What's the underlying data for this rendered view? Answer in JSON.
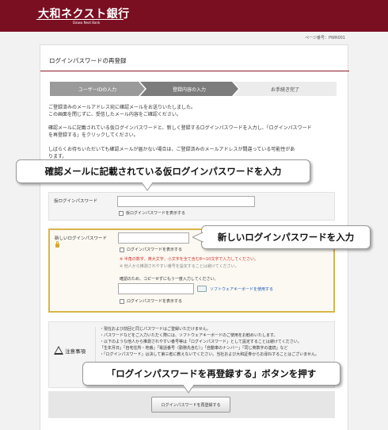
{
  "header": {
    "logo": "大和ネクスト銀行",
    "logo_sub": "Daiwa Next Bank",
    "brand_color": "#7a0f22"
  },
  "page_no": "ページ番号：PWR001",
  "card": {
    "title": "ログインパスワードの再登録",
    "steps": [
      {
        "label": "ユーザーIDの入力",
        "state": "done"
      },
      {
        "label": "登録内容の入力",
        "state": "current"
      },
      {
        "label": "お手続き完了",
        "state": "todo"
      }
    ],
    "intro": [
      "ご登録済みのメールアドレス宛に確認メールをお送りいたしました。",
      "この画面を閉じずに、受信したメール内容をご確認ください。"
    ],
    "instructions": [
      "確認メールに記載されている仮ログインパスワードと、新しく登録するログインパスワードを入力し、「ログインパスワード",
      "を再登録する」をクリックしてください。"
    ],
    "info": [
      "しばらくお待ちいただいても確認メールが届かない場合は、ご登録済みのメールアドレスが間違っている可能性があ",
      "ります。"
    ]
  },
  "temp_password": {
    "label": "仮ログインパスワード",
    "value": "",
    "show_label": "仮ログインパスワードを表示する"
  },
  "new_password": {
    "label": "新しいログインパスワード",
    "value": "",
    "show_label": "ログインパスワードを表示する",
    "rule_warning": "※ 半角の数字、英大文字、小文字を全て含む8〜10文字で入力してください。",
    "rule_note": "※ 他人から推測されやすい番号を設定することは避けてください。",
    "confirm_label": "確認のため、コピーせずにもう一度入力してください。",
    "confirm_value": "",
    "keyboard_link": "ソフトウェアキーボードを使用する",
    "confirm_show_label": "ログインパスワードを表示する"
  },
  "caution": {
    "title": "注意事項",
    "lines": [
      "・現在および前回と同じパスワードはご登録いただけません。",
      "・パスワードなどをご入力いただく際には、ソフトウェアキーボードのご使用をお勧めいたします。",
      "・以下のような他人から推測されやすい番号等は「ログインパスワード」として設定することは避けてください。",
      "「生年月日」「自宅住所・地番」「電話番号（勤務先含む）」「自動車のナンバー」「同じ英数字の連続」など",
      "・「ログインパスワード」は決して第三者に教えないでください。当社および大和証券からお尋ねすることはございません。"
    ]
  },
  "submit": {
    "label": "ログインパスワードを再登録する"
  },
  "callouts": {
    "temp": "確認メールに記載されている仮ログインパスワードを入力",
    "new": "新しいログインパスワードを入力",
    "submit": "「ログインパスワードを再登録する」ボタンを押す"
  }
}
